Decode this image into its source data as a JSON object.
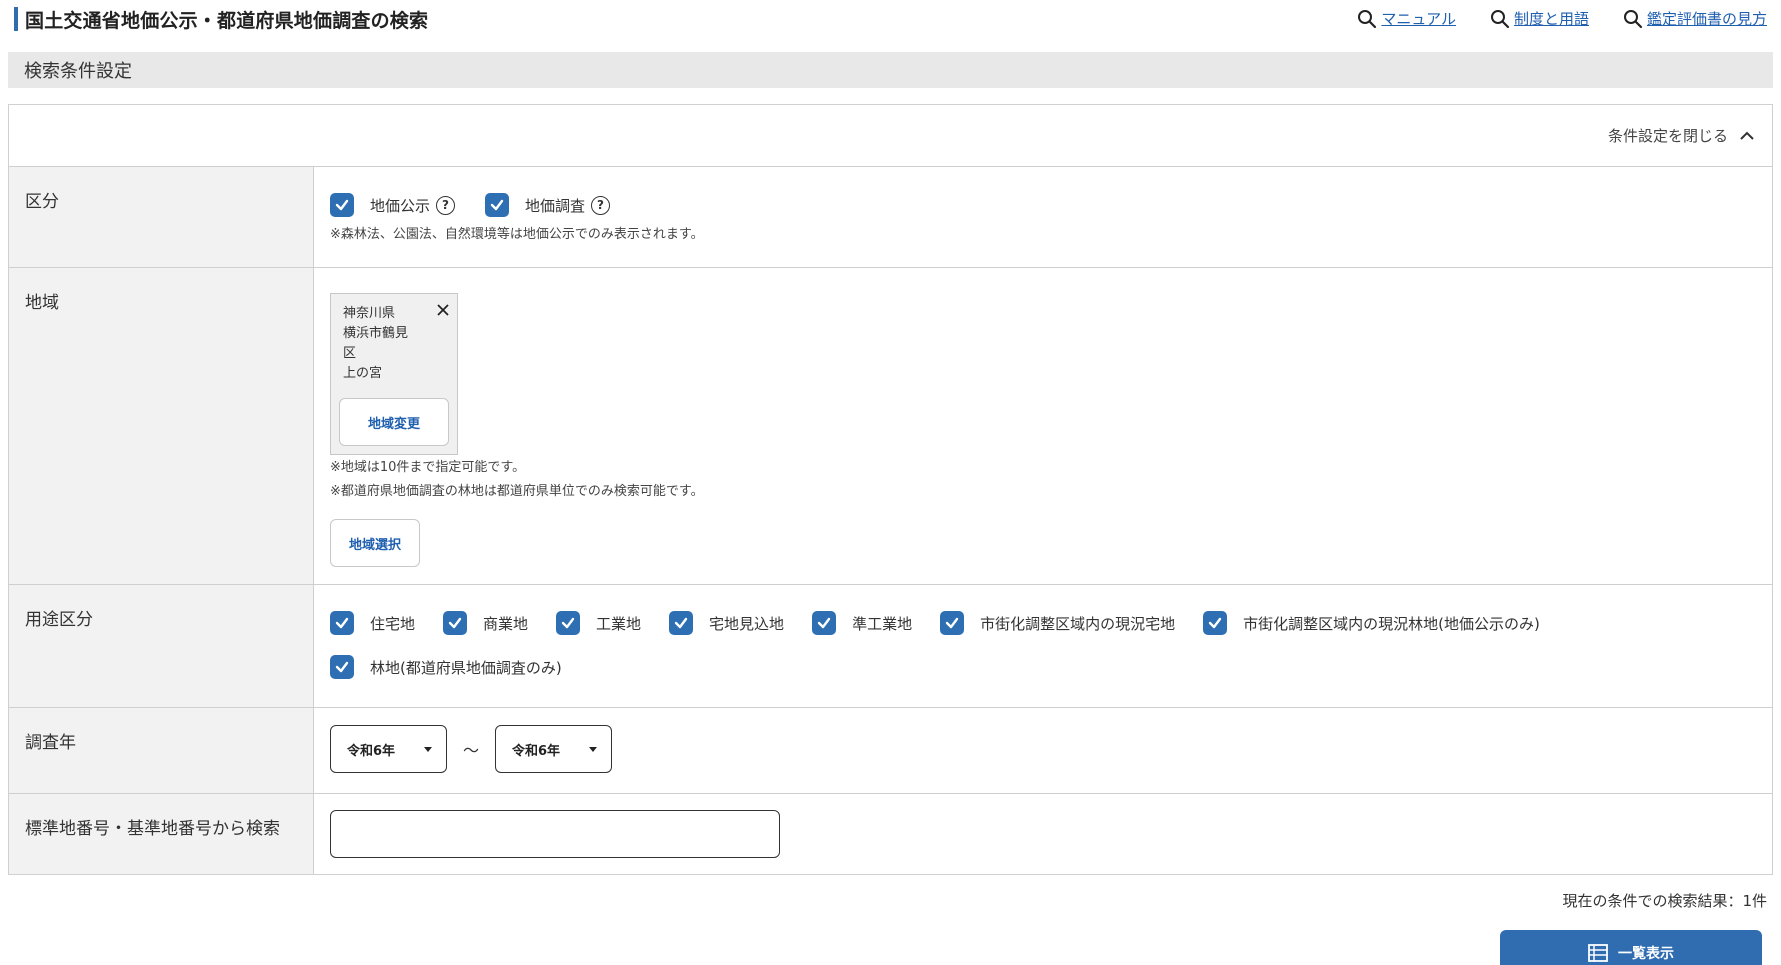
{
  "header": {
    "title": "国土交通省地価公示・都道府県地価調査の検索",
    "links": [
      {
        "label": "マニュアル"
      },
      {
        "label": "制度と用語"
      },
      {
        "label": "鑑定評価書の見方"
      }
    ]
  },
  "section": {
    "title": "検索条件設定",
    "collapse_label": "条件設定を閉じる"
  },
  "rows": {
    "kubun": {
      "label": "区分",
      "options": [
        {
          "label": "地価公示",
          "checked": true
        },
        {
          "label": "地価調査",
          "checked": true
        }
      ],
      "help_glyph": "?",
      "note": "※森林法、公園法、自然環境等は地価公示でのみ表示されます。"
    },
    "area": {
      "label": "地域",
      "chip_lines": [
        "神奈川県",
        "横浜市鶴見",
        "区",
        "上の宮"
      ],
      "change_button": "地域変更",
      "notes": [
        "※地域は10件まで指定可能です。",
        "※都道府県地価調査の林地は都道府県単位でのみ検索可能です。"
      ],
      "select_button": "地域選択"
    },
    "usage": {
      "label": "用途区分",
      "options": [
        {
          "label": "住宅地",
          "checked": true
        },
        {
          "label": "商業地",
          "checked": true
        },
        {
          "label": "工業地",
          "checked": true
        },
        {
          "label": "宅地見込地",
          "checked": true
        },
        {
          "label": "準工業地",
          "checked": true
        },
        {
          "label": "市街化調整区域内の現況宅地",
          "checked": true
        },
        {
          "label": "市街化調整区域内の現況林地(地価公示のみ)",
          "checked": true
        },
        {
          "label": "林地(都道府県地価調査のみ)",
          "checked": true
        }
      ]
    },
    "year": {
      "label": "調査年",
      "from": "令和6年",
      "separator": "～",
      "to": "令和6年"
    },
    "number": {
      "label": "標準地番号・基準地番号から検索",
      "value": "",
      "placeholder": ""
    }
  },
  "results": {
    "count_text": "現在の条件での検索結果：1件",
    "list_button": "一覧表示"
  },
  "colors": {
    "accent": "#2f6db0",
    "checkbox": "#2e6fb4",
    "label_bg": "#f2f2f2",
    "section_bg": "#e8e8e8"
  }
}
